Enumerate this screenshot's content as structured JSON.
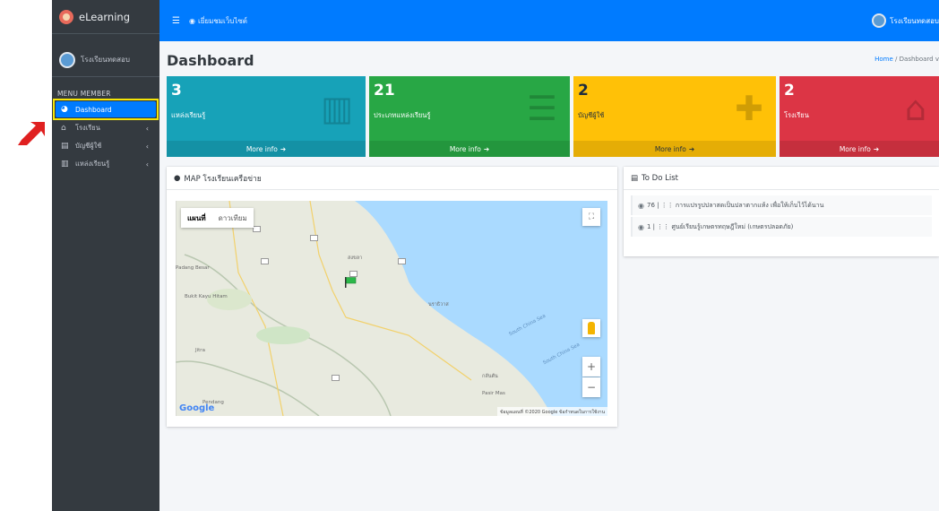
{
  "brand": {
    "name": "eLearning"
  },
  "sidebar": {
    "user_name": "โรงเรียนทดสอบ",
    "menu_header": "MENU MEMBER",
    "items": [
      {
        "label": "Dashboard",
        "icon": "dashboard-icon",
        "active": true
      },
      {
        "label": "โรงเรียน",
        "icon": "school-icon",
        "chevron": "‹"
      },
      {
        "label": "บัญชีผู้ใช้",
        "icon": "id-card-icon",
        "chevron": "‹"
      },
      {
        "label": "แหล่งเรียนรู้",
        "icon": "book-icon",
        "chevron": "‹"
      }
    ]
  },
  "topbar": {
    "view_site_label": "เยี่ยมชมเว็บไซต์",
    "user_name": "โรงเรียนทดสอบ"
  },
  "content": {
    "title": "Dashboard",
    "breadcrumb_home": "Home",
    "breadcrumb_current": "Dashboard v"
  },
  "info_boxes": [
    {
      "count": "3",
      "label": "แหล่งเรียนรู้",
      "more": "More info",
      "color": "#17a2b8",
      "icon": "book-icon"
    },
    {
      "count": "21",
      "label": "ประเภทแหล่งเรียนรู้",
      "more": "More info",
      "color": "#28a745",
      "icon": "list-icon"
    },
    {
      "count": "2",
      "label": "บัญชีผู้ใช้",
      "more": "More info",
      "color": "#ffc107",
      "icon": "user-plus-icon"
    },
    {
      "count": "2",
      "label": "โรงเรียน",
      "more": "More info",
      "color": "#dc3545",
      "icon": "school-icon"
    }
  ],
  "map_card": {
    "title": "MAP โรงเรียนเครือข่าย",
    "map_type_map": "แผนที่",
    "map_type_satellite": "ดาวเทียม",
    "google_label": "Google",
    "attribution": "ข้อมูลแผนที่ ©2020 Google   ข้อกำหนดในการใช้งาน",
    "sea_label": "South China Sea",
    "place_labels": [
      "สงขลา",
      "นราธิวาส",
      "กลันตัน",
      "Padang Besar",
      "Pasir Mas",
      "Bukit Kayu Hitam",
      "Jitra",
      "Pendang"
    ]
  },
  "todo_card": {
    "title": "To Do List",
    "items": [
      {
        "label": "76 | ⋮⋮ การแปรรูปปลาสดเป็นปลาตากแห้ง เพื่อให้เก็บไว้ได้นาน"
      },
      {
        "label": "1 | ⋮⋮ ศูนย์เรียนรู้เกษตรทฤษฎีใหม่ (เกษตรปลอดภัย)"
      }
    ]
  }
}
